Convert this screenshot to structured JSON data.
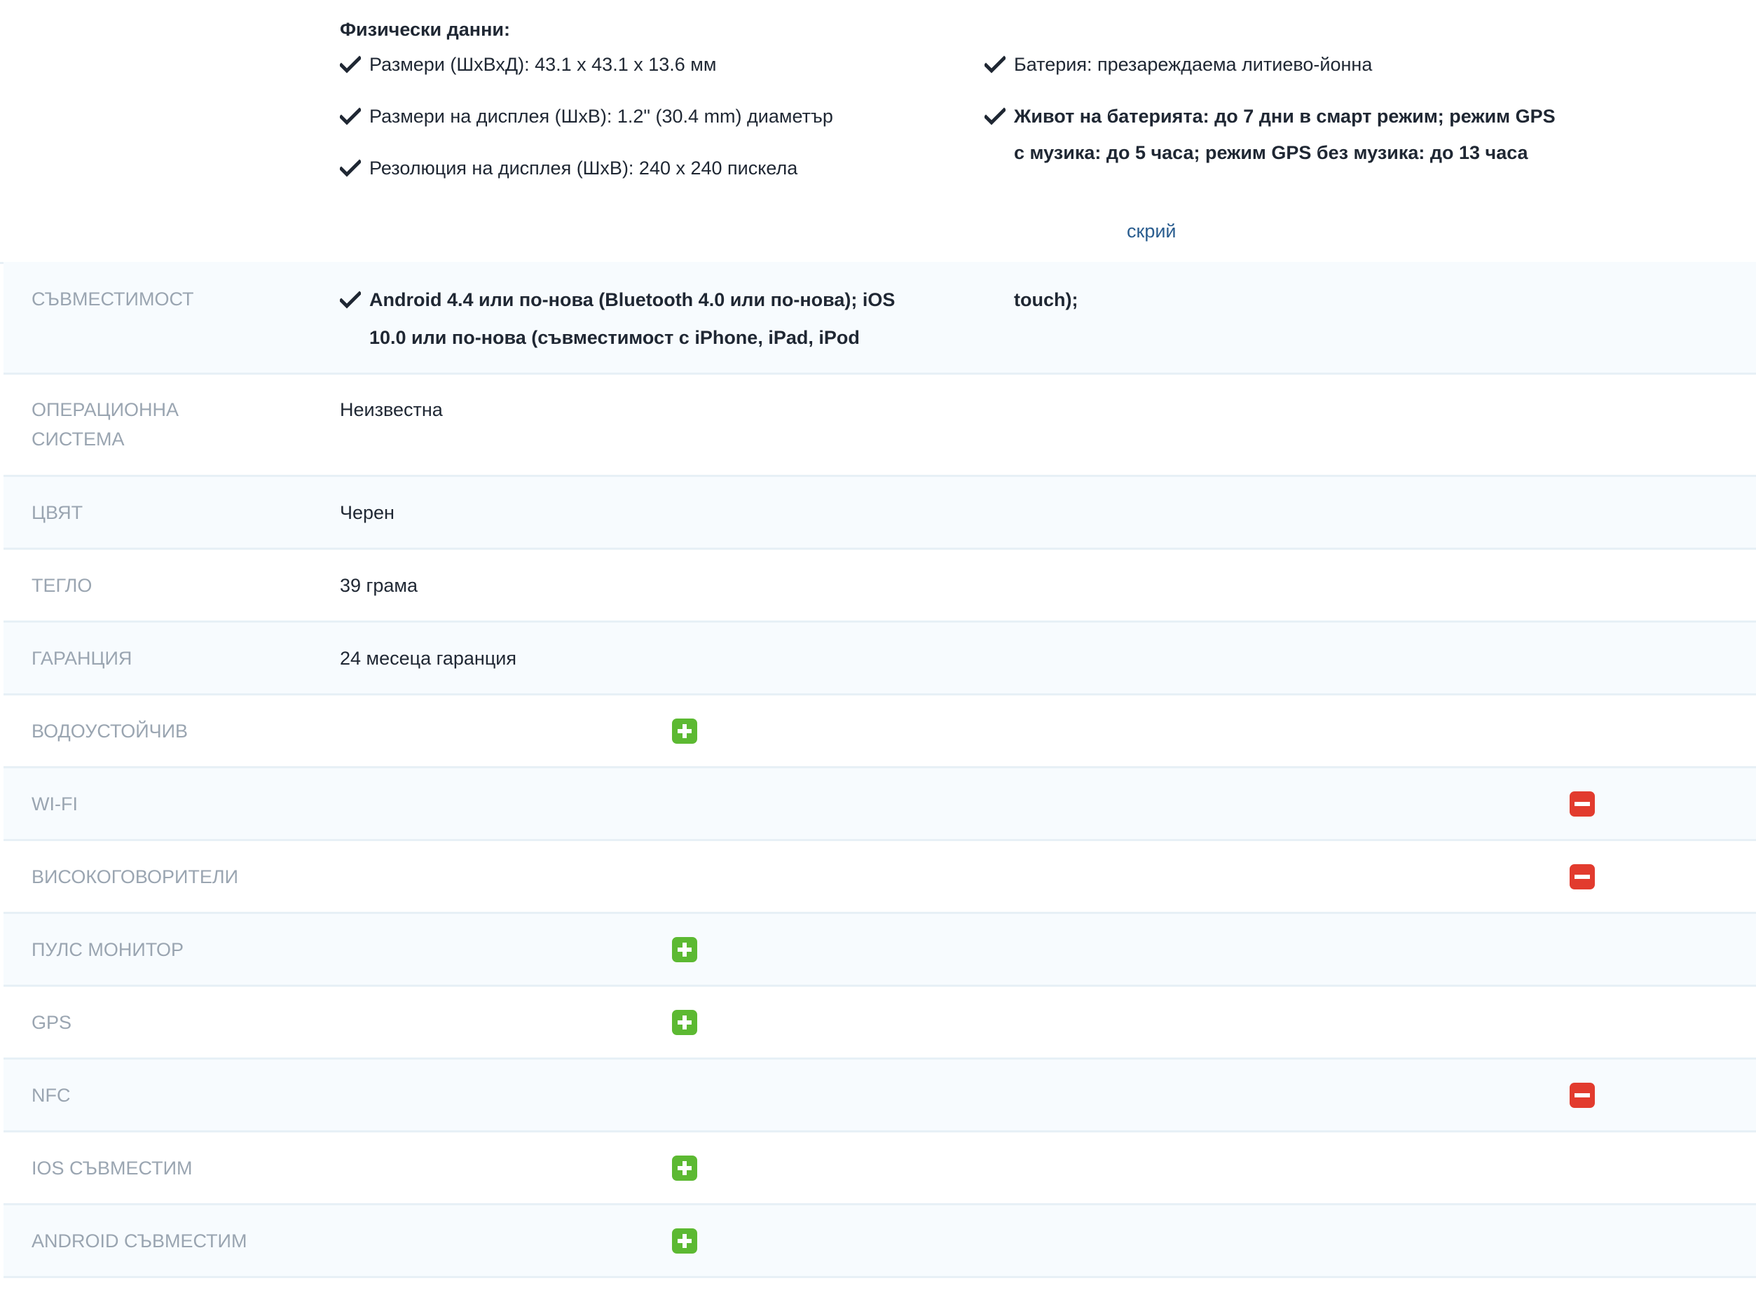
{
  "physical": {
    "title": "Физически данни:",
    "left_features": [
      "Размери (ШхВхД): 43.1 x 43.1 x 13.6 мм",
      "Размери на дисплея (ШхВ): 1.2\" (30.4 mm) диаметър",
      "Резолюция на дисплея (ШхВ): 240 x 240 пискела"
    ],
    "right_features": [
      "Батерия: презареждаема литиево-йонна",
      "Живот на батерията: до 7 дни в смарт режим; режим GPS с музика: до 5 часа; режим GPS без музика: до 13 часа"
    ],
    "toggle_label": "скрий"
  },
  "specs": {
    "compatibility": {
      "label": "СЪВМЕСТИМОСТ",
      "text_left": "Android 4.4 или по-нова (Bluetooth 4.0 или по-нова); iOS 10.0 или по-нова (съвместимост с iPhone, iPad, iPod",
      "text_right": "touch);"
    },
    "os": {
      "label": "ОПЕРАЦИОННА СИСТЕМА",
      "value": "Неизвестна"
    },
    "color": {
      "label": "ЦВЯТ",
      "value": "Черен"
    },
    "weight": {
      "label": "ТЕГЛО",
      "value": "39 грама"
    },
    "warranty": {
      "label": "ГАРАНЦИЯ",
      "value": "24 месеца гаранция"
    },
    "features": [
      {
        "label": "ВОДОУСТОЙЧИВ",
        "available": true,
        "icon": "plus-icon"
      },
      {
        "label": "WI-FI",
        "available": false,
        "icon": "minus-icon"
      },
      {
        "label": "ВИСОКОГОВОРИТЕЛИ",
        "available": false,
        "icon": "minus-icon"
      },
      {
        "label": "ПУЛС МОНИТОР",
        "available": true,
        "icon": "plus-icon"
      },
      {
        "label": "GPS",
        "available": true,
        "icon": "plus-icon"
      },
      {
        "label": "NFC",
        "available": false,
        "icon": "minus-icon"
      },
      {
        "label": "IOS СЪВМЕСТИМ",
        "available": true,
        "icon": "plus-icon"
      },
      {
        "label": "ANDROID СЪВМЕСТИМ",
        "available": true,
        "icon": "plus-icon"
      }
    ]
  },
  "colors": {
    "yes": "#5cb932",
    "no": "#e23b2e",
    "label": "#9aa5b1",
    "link": "#2a5d8f"
  }
}
